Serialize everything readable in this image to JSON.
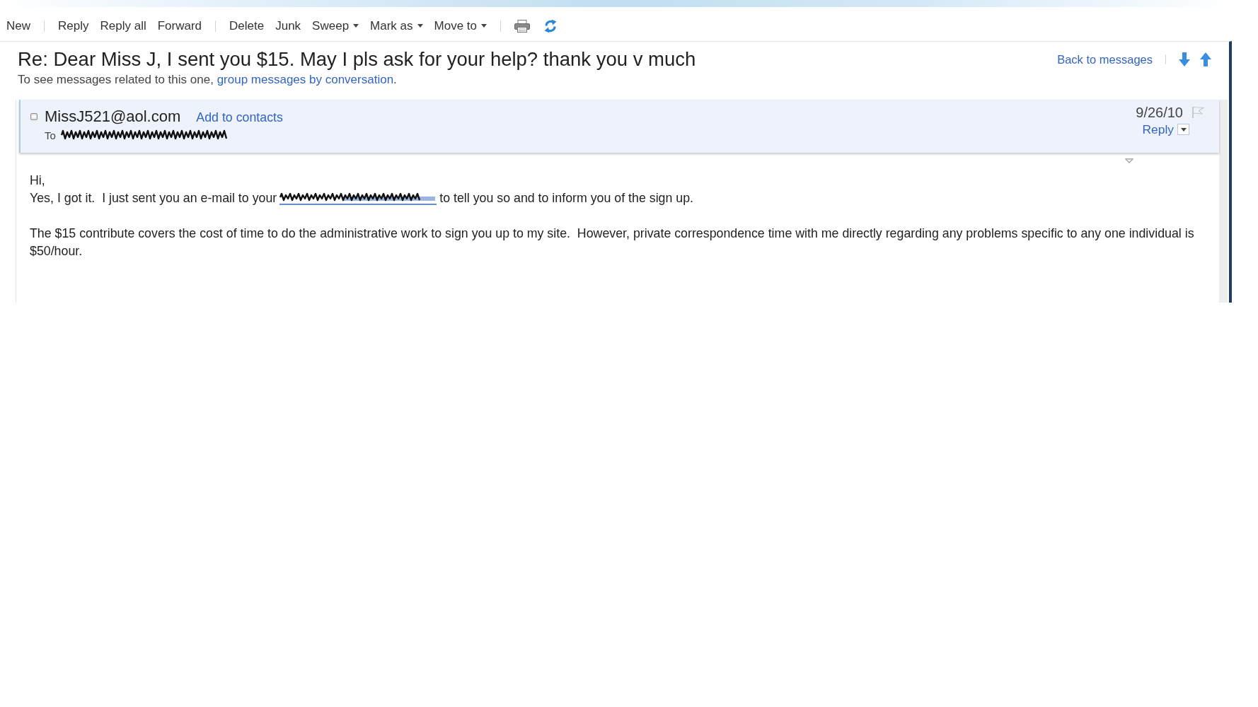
{
  "toolbar": {
    "groups": [
      [
        {
          "label": "New",
          "dropdown": false
        }
      ],
      [
        {
          "label": "Reply",
          "dropdown": false
        },
        {
          "label": "Reply all",
          "dropdown": false
        },
        {
          "label": "Forward",
          "dropdown": false
        }
      ],
      [
        {
          "label": "Delete",
          "dropdown": false
        },
        {
          "label": "Junk",
          "dropdown": false
        },
        {
          "label": "Sweep",
          "dropdown": true
        },
        {
          "label": "Mark as",
          "dropdown": true
        },
        {
          "label": "Move to",
          "dropdown": true
        }
      ]
    ]
  },
  "message": {
    "subject": "Re: Dear Miss J, I sent you $15. May I pls ask for your help? thank you v much",
    "conversation_hint": {
      "text": "To see messages related to this one,",
      "link": "group messages by conversation",
      "end": "."
    },
    "back_link": "Back to messages",
    "header": {
      "sender": "MissJ521@aol.com",
      "add_to_contacts": "Add to contacts",
      "to_label": "To",
      "date": "9/26/10",
      "flagged": false,
      "reply": "Reply"
    },
    "body": {
      "greeting": "Hi,",
      "line_before_link": "Yes, I got it.  I just sent you an e-mail to your",
      "line_after_link": "to tell you so and to inform you of the sign up.",
      "paragraph": "The $15 contribute covers the cost of time to do the administrative work to sign you up to my site.  However, private correspondence time with me directly regarding any problems specific to any one individual is $50/hour."
    }
  }
}
